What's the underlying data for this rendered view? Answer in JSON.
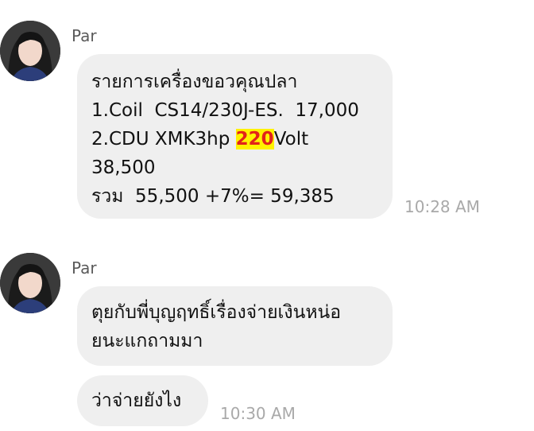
{
  "messages": [
    {
      "sender": "Par",
      "avatar": "profile-photo",
      "bubble_lines": [
        "รายการเครื่องขอวคุณปลา",
        "1.Coil  CS14/230J-ES.  17,000",
        "2.CDU XMK3hp ",
        "38,500",
        "รวม  55,500 +7%= 59,385"
      ],
      "highlight": "220",
      "after_highlight": "Volt",
      "time": "10:28 AM"
    },
    {
      "sender": "Par",
      "avatar": "profile-photo",
      "bubble_lines": [
        "ตุยกับพี่บุญฤทธิ์เรื่องจ่ายเงินหน่อ",
        "ยนะแกถามมา"
      ]
    },
    {
      "bubble_lines": [
        "ว่าจ่ายยังไง"
      ],
      "time": "10:30 AM"
    }
  ],
  "colors": {
    "bubble": "#efefef",
    "highlight_bg": "#fff200",
    "highlight_text": "#e2231a",
    "timestamp": "#a9a9a9"
  }
}
